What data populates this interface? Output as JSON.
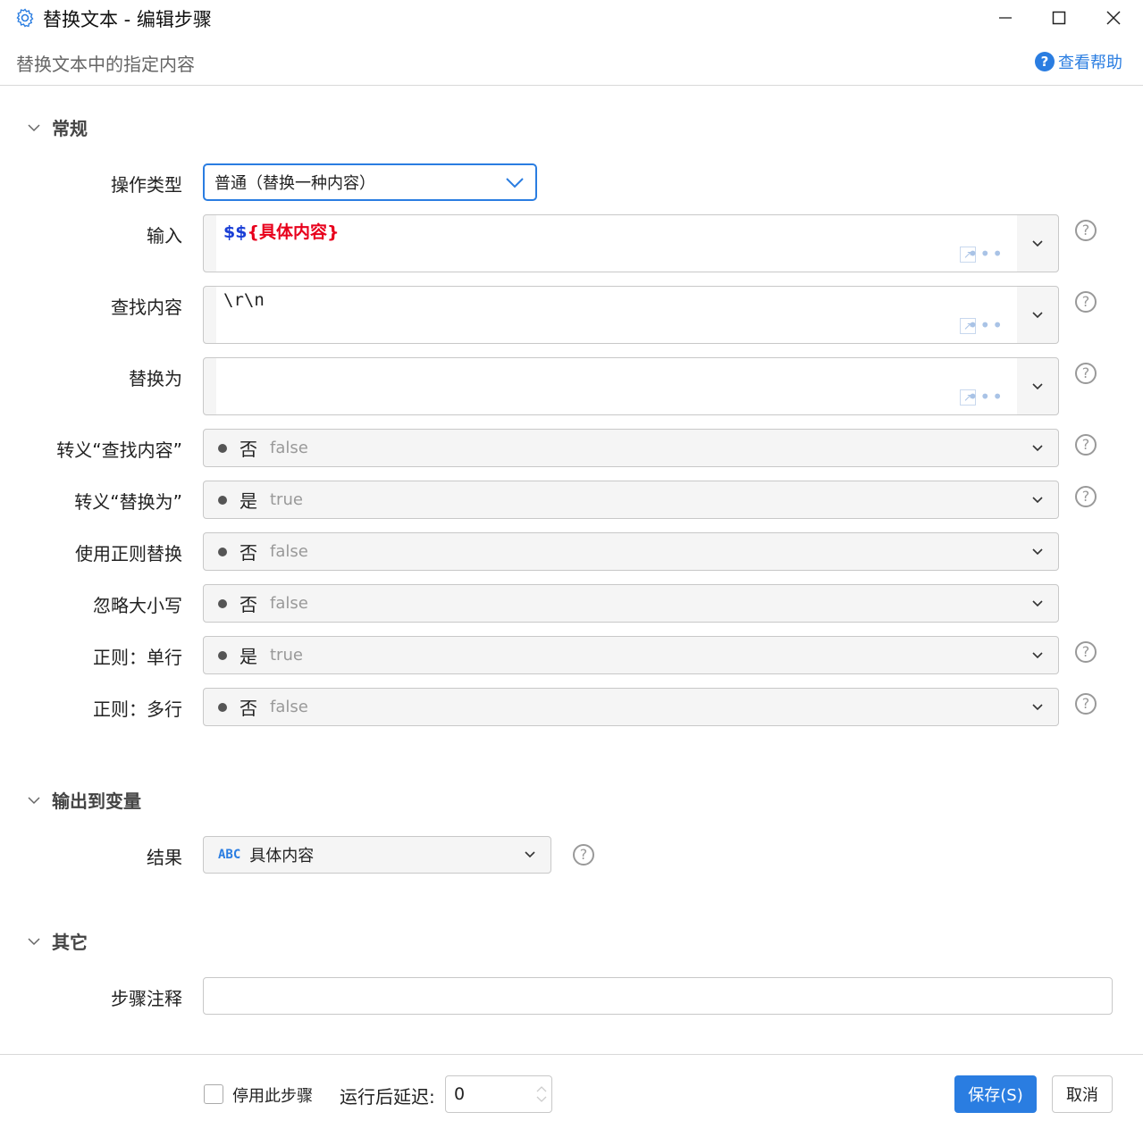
{
  "window": {
    "title": "替换文本 - 编辑步骤",
    "subtitle": "替换文本中的指定内容",
    "help_label": "查看帮助",
    "accent": "#2a7de1"
  },
  "sections": {
    "general": "常规",
    "output": "输出到变量",
    "other": "其它"
  },
  "fields": {
    "op_type": {
      "label": "操作类型",
      "value": "普通（替换一种内容）"
    },
    "input": {
      "label": "输入",
      "prefix": "$$",
      "var": "{具体内容}"
    },
    "find": {
      "label": "查找内容",
      "value": "\\r\\n"
    },
    "replace": {
      "label": "替换为",
      "value": ""
    },
    "escape_find": {
      "label": "转义“查找内容”",
      "text": "否",
      "value": "false"
    },
    "escape_replace": {
      "label": "转义“替换为”",
      "text": "是",
      "value": "true"
    },
    "use_regex": {
      "label": "使用正则替换",
      "text": "否",
      "value": "false"
    },
    "ignore_case": {
      "label": "忽略大小写",
      "text": "否",
      "value": "false"
    },
    "regex_single": {
      "label": "正则：单行",
      "text": "是",
      "value": "true"
    },
    "regex_multi": {
      "label": "正则：多行",
      "text": "否",
      "value": "false"
    },
    "result": {
      "label": "结果",
      "type_badge": "ABC",
      "value": "具体内容"
    },
    "comment": {
      "label": "步骤注释",
      "value": ""
    }
  },
  "footer": {
    "disable_label": "停用此步骤",
    "delay_label": "运行后延迟:",
    "delay_value": "0",
    "save_label": "保存(S)",
    "cancel_label": "取消"
  }
}
